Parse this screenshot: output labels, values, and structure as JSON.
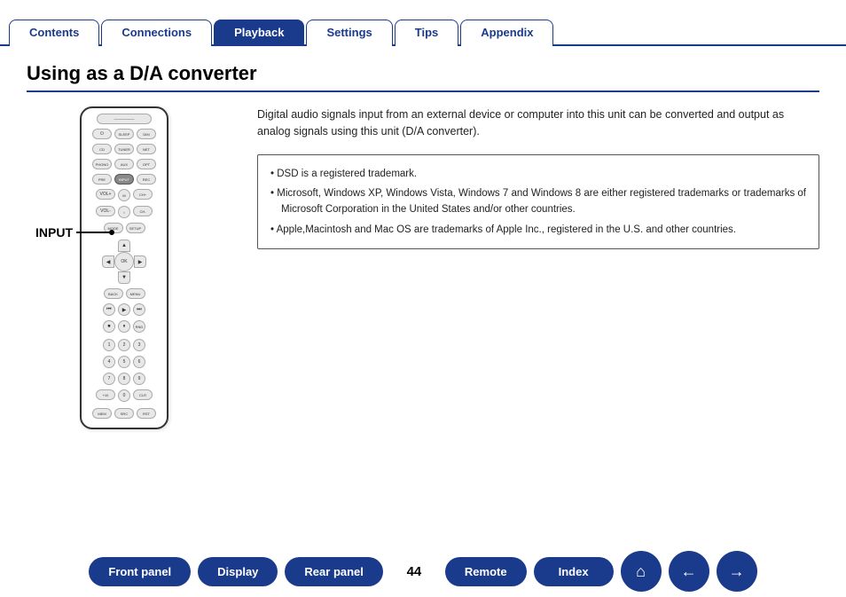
{
  "nav": {
    "tabs": [
      {
        "label": "Contents",
        "active": false
      },
      {
        "label": "Connections",
        "active": false
      },
      {
        "label": "Playback",
        "active": true
      },
      {
        "label": "Settings",
        "active": false
      },
      {
        "label": "Tips",
        "active": false
      },
      {
        "label": "Appendix",
        "active": false
      }
    ]
  },
  "page": {
    "title": "Using as a D/A converter",
    "number": "44"
  },
  "content": {
    "description": "Digital audio signals input from an external device or computer into this unit can be converted and output as analog signals using this unit (D/A converter).",
    "info_bullets": [
      "• DSD is a registered trademark.",
      "• Microsoft, Windows XP, Windows Vista, Windows 7 and Windows 8 are either registered trademarks or trademarks of Microsoft Corporation in the United States and/or other countries.",
      "• Apple,Macintosh and Mac OS are trademarks of Apple Inc., registered in the U.S. and other countries."
    ],
    "input_label": "INPUT"
  },
  "bottom_nav": {
    "buttons": [
      {
        "label": "Front panel",
        "id": "front-panel"
      },
      {
        "label": "Display",
        "id": "display"
      },
      {
        "label": "Rear panel",
        "id": "rear-panel"
      },
      {
        "label": "Remote",
        "id": "remote"
      },
      {
        "label": "Index",
        "id": "index"
      }
    ],
    "icons": [
      {
        "label": "⌂",
        "id": "home"
      },
      {
        "label": "←",
        "id": "back"
      },
      {
        "label": "→",
        "id": "forward"
      }
    ]
  }
}
